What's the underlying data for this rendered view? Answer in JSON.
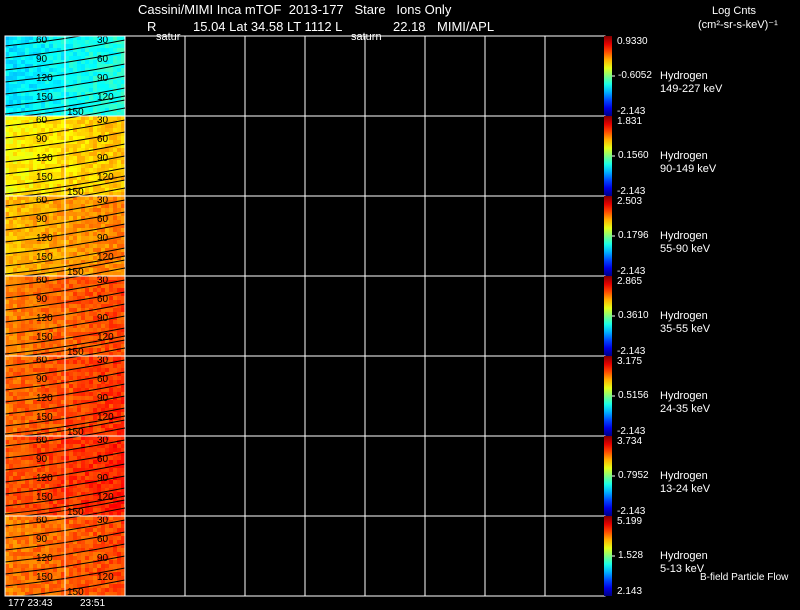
{
  "header": {
    "title_line": "Cassini/MIMI Inca mTOF  2013-177   Stare   Ions Only",
    "r_label": "R",
    "position_line": "15.04 Lat 34.58 LT 1112 L",
    "l_value": "22.18",
    "credit": "MIMI/APL",
    "planet_label_1": "satur",
    "planet_label_2": "saturn"
  },
  "units": {
    "line1": "Log Cnts",
    "line2": "(cm²-sr-s-keV)⁻¹"
  },
  "footer": {
    "time_left": "177 23:43",
    "time_right": "23:51",
    "note": "B-field Particle Flow"
  },
  "colors": {
    "background": "#000000",
    "grid": "#ffffff",
    "contour": "#000000"
  },
  "chart_data": {
    "type": "heatmap",
    "panels": [
      {
        "species": "Hydrogen",
        "energy": "149-227 keV",
        "cmax": "0.9330",
        "cmid": "-0.6052",
        "cmin": "-2.143",
        "level": 0.4,
        "contour_labels_left": [
          "60",
          "90",
          "120",
          "150"
        ],
        "contour_labels_right": [
          "30",
          "60",
          "90",
          "120"
        ],
        "bottom_label": "150"
      },
      {
        "species": "Hydrogen",
        "energy": "90-149 keV",
        "cmax": "1.831",
        "cmid": "0.1560",
        "cmin": "-2.143",
        "level": 0.68,
        "contour_labels_left": [
          "60",
          "90",
          "120",
          "150"
        ],
        "contour_labels_right": [
          "30",
          "60",
          "90",
          "120"
        ],
        "bottom_label": "150"
      },
      {
        "species": "Hydrogen",
        "energy": "55-90 keV",
        "cmax": "2.503",
        "cmid": "0.1796",
        "cmin": "-2.143",
        "level": 0.74,
        "contour_labels_left": [
          "60",
          "90",
          "120",
          "150"
        ],
        "contour_labels_right": [
          "30",
          "60",
          "90",
          "120"
        ],
        "bottom_label": "150"
      },
      {
        "species": "Hydrogen",
        "energy": "35-55 keV",
        "cmax": "2.865",
        "cmid": "0.3610",
        "cmin": "-2.143",
        "level": 0.8,
        "contour_labels_left": [
          "60",
          "90",
          "120",
          "150"
        ],
        "contour_labels_right": [
          "30",
          "60",
          "90",
          "120"
        ],
        "bottom_label": "150"
      },
      {
        "species": "Hydrogen",
        "energy": "24-35 keV",
        "cmax": "3.175",
        "cmid": "0.5156",
        "cmin": "-2.143",
        "level": 0.82,
        "contour_labels_left": [
          "60",
          "90",
          "120",
          "150"
        ],
        "contour_labels_right": [
          "30",
          "60",
          "90",
          "120"
        ],
        "bottom_label": "150"
      },
      {
        "species": "Hydrogen",
        "energy": "13-24 keV",
        "cmax": "3.734",
        "cmid": "0.7952",
        "cmin": "-2.143",
        "level": 0.84,
        "contour_labels_left": [
          "60",
          "90",
          "120",
          "150"
        ],
        "contour_labels_right": [
          "30",
          "60",
          "90",
          "120"
        ],
        "bottom_label": "150"
      },
      {
        "species": "Hydrogen",
        "energy": "5-13 keV",
        "cmax": "5.199",
        "cmid": "1.528",
        "cmin": "2.143",
        "level": 0.8,
        "contour_labels_left": [
          "60",
          "90",
          "120",
          "150"
        ],
        "contour_labels_right": [
          "30",
          "60",
          "90",
          "120"
        ],
        "bottom_label": "150"
      }
    ]
  }
}
